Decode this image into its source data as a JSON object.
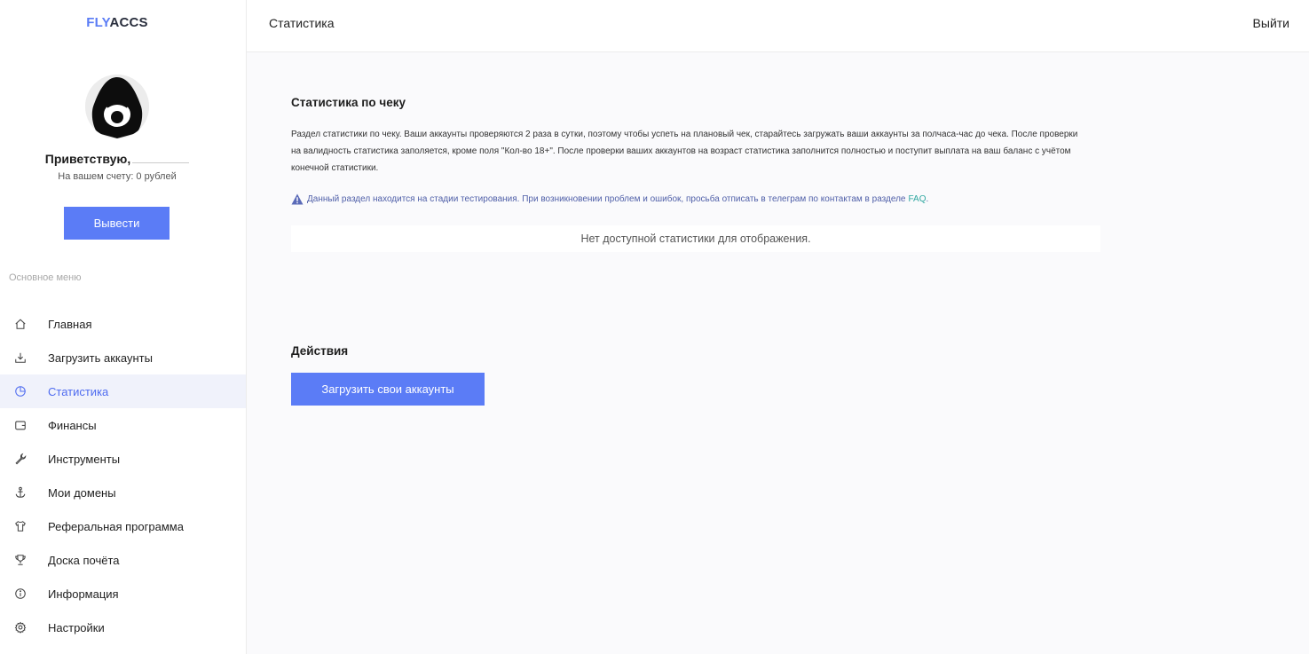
{
  "brand": {
    "part1": "FLY",
    "part2": "ACCS",
    "accent_color": "#5a7cf5"
  },
  "user": {
    "greeting": "Приветствую,",
    "balance_text": "На вашем счету: 0 рублей",
    "withdraw_label": "Вывести"
  },
  "menu": {
    "caption": "Основное меню",
    "items": [
      {
        "label": "Главная",
        "icon": "home-icon",
        "active": false
      },
      {
        "label": "Загрузить аккаунты",
        "icon": "upload-icon",
        "active": false
      },
      {
        "label": "Статистика",
        "icon": "pie-chart-icon",
        "active": true
      },
      {
        "label": "Финансы",
        "icon": "wallet-icon",
        "active": false
      },
      {
        "label": "Инструменты",
        "icon": "wrench-icon",
        "active": false
      },
      {
        "label": "Мои домены",
        "icon": "anchor-icon",
        "active": false
      },
      {
        "label": "Реферальная программа",
        "icon": "shirt-icon",
        "active": false
      },
      {
        "label": "Доска почёта",
        "icon": "trophy-icon",
        "active": false
      },
      {
        "label": "Информация",
        "icon": "info-icon",
        "active": false
      },
      {
        "label": "Настройки",
        "icon": "gear-icon",
        "active": false
      }
    ]
  },
  "topbar": {
    "title": "Статистика",
    "logout_label": "Выйти"
  },
  "stats": {
    "title": "Статистика по чеку",
    "description": "Раздел статистики по чеку. Ваши аккаунты проверяются 2 раза в сутки, поэтому чтобы успеть на плановый чек, старайтесь загружать ваши аккаунты за полчаса-час до чека. После проверки на валидность статистика заполяется, кроме поля \"Кол-во 18+\". После проверки ваших аккаунтов на возраст статистика заполнится полностью и поступит выплата на ваш баланс с учётом конечной статистики.",
    "notice": "Данный раздел находится на стадии тестирования. При возникновении проблем и ошибок, просьба отписать в телеграм по контактам в разделе",
    "notice_link": "FAQ",
    "empty": "Нет доступной статистики для отображения."
  },
  "actions": {
    "title": "Действия",
    "upload_label": "Загрузить свои аккаунты"
  },
  "colors": {
    "primary": "#5b7cf6",
    "active_bg": "#f0f2fb",
    "link": "#2fa7a0"
  }
}
